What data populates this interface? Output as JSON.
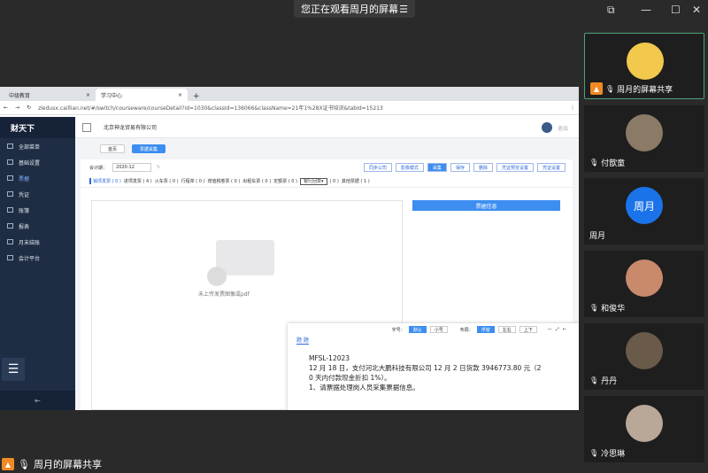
{
  "banner": {
    "text": "您正在观看周月的屏幕",
    "menu_icon": "menu-icon"
  },
  "window_controls": {
    "restore": "⧉",
    "minimize": "—",
    "maximize": "☐",
    "close": "✕"
  },
  "browser": {
    "tabs": [
      {
        "label": "中级教育"
      },
      {
        "label": "学习中心"
      }
    ],
    "url": "zledusx.caillian.net/#/switch/courseware/courseDetail?id=1030&classId=136066&className=21年1%28X证书培训&tabId=15213"
  },
  "sidebar": {
    "logo": "财天下",
    "items": [
      {
        "label": "全部菜单"
      },
      {
        "label": "基础设置"
      },
      {
        "label": "票据"
      },
      {
        "label": "凭证"
      },
      {
        "label": "账簿"
      },
      {
        "label": "报表"
      },
      {
        "label": "月末结账"
      },
      {
        "label": "会计平台"
      }
    ]
  },
  "header": {
    "company": "北京神龙贸易有限公司",
    "user": "退出"
  },
  "subtabs": [
    {
      "label": "首页"
    },
    {
      "label": "票据采集"
    }
  ],
  "toolbar": {
    "period_label": "会计期：",
    "period_value": "2020-12",
    "buttons": [
      "同步公司",
      "影像模式",
      "采集",
      "保存",
      "删除",
      "凭证预览设置",
      "凭证设置"
    ]
  },
  "categories": {
    "items": [
      "销项发票 ( 0 )",
      "进项发票 ( 4 )",
      "火车票 ( 0 )",
      "行程单 ( 0 )",
      "增值税卷票 ( 0 )",
      "出租车票 ( 0 )",
      "定额票 ( 0 )"
    ],
    "select_value": "银行回单",
    "select_count": "( 0 )",
    "other": "其他票据 ( 1 )"
  },
  "preview": {
    "empty_text": "未上传发票图像或pdf"
  },
  "info_panel": {
    "title": "票据信息"
  },
  "float_panel": {
    "font_label": "字号：",
    "font_options": [
      "默认",
      "小号"
    ],
    "layout_label": "布局：",
    "layout_options": [
      "浮窗",
      "左右",
      "上下"
    ],
    "tab": "题 题",
    "lines": [
      "MFSL-12023",
      "12 月 18 日，支付河北大鹏科技有限公司 12 月 2 日货款 3946773.80 元（2",
      "0 天内付款现金折扣 1%）。",
      "1、请票据处理岗人员采集票据信息。"
    ]
  },
  "participants": [
    {
      "name": "周月的屏幕共享",
      "color": "#f2c94c"
    },
    {
      "name": "付歆童",
      "color": "#8a7a66"
    },
    {
      "name": "周月",
      "avatar_text": "周月",
      "color": "#1a73e8"
    },
    {
      "name": "和俊华",
      "color": "#c98a6c"
    },
    {
      "name": "丹丹",
      "color": "#6a5a4a"
    },
    {
      "name": "冷思琳",
      "color": "#b9a898"
    }
  ],
  "footer": {
    "label": "周月的屏幕共享"
  }
}
